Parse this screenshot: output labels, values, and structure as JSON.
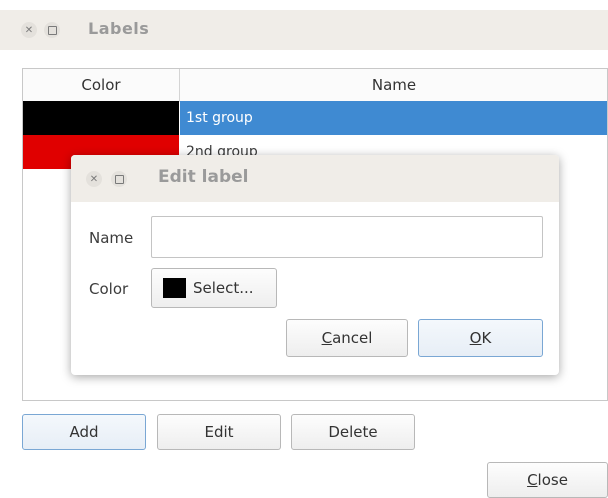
{
  "window": {
    "title": "Labels"
  },
  "table": {
    "headers": {
      "color": "Color",
      "name": "Name"
    },
    "rows": [
      {
        "name": "1st group",
        "color": "#000000",
        "selected": true
      },
      {
        "name": "2nd group",
        "color": "#e00000",
        "selected": false
      }
    ]
  },
  "buttons": {
    "add": "Add",
    "edit": "Edit",
    "delete": "Delete",
    "close_mn": "C",
    "close_rest": "lose"
  },
  "dialog": {
    "title": "Edit label",
    "name_label": "Name",
    "name_value": "",
    "color_label": "Color",
    "select_label": "Select...",
    "selected_color": "#000000",
    "cancel_mn": "C",
    "cancel_rest": "ancel",
    "ok_mn": "O",
    "ok_rest": "K"
  }
}
